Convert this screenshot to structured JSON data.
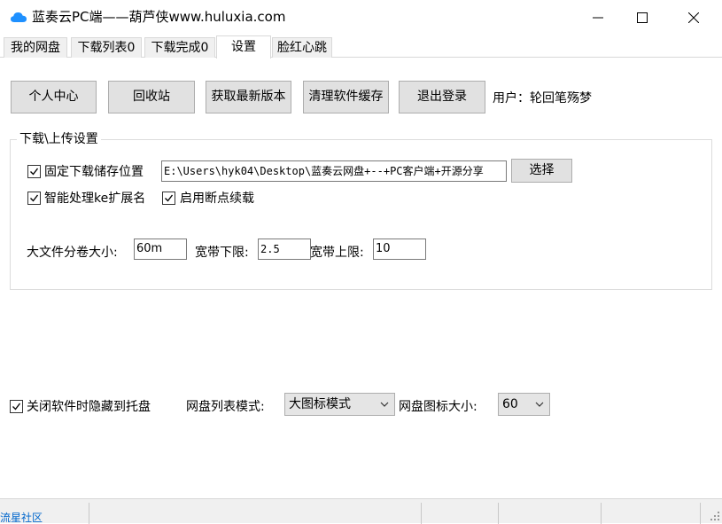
{
  "window": {
    "title": "蓝奏云PC端——葫芦侠www.huluxia.com",
    "icon": "cloud-icon",
    "icon_color": "#1e90ff"
  },
  "tabs": [
    {
      "label": "我的网盘",
      "active": false
    },
    {
      "label": "下载列表0",
      "active": false
    },
    {
      "label": "下载完成0",
      "active": false
    },
    {
      "label": "设置",
      "active": true
    },
    {
      "label": "脸红心跳",
      "active": false
    }
  ],
  "toolbar": {
    "personal_center": "个人中心",
    "recycle_bin": "回收站",
    "get_latest": "获取最新版本",
    "clear_cache": "清理软件缓存",
    "logout": "退出登录",
    "user_label": "用户：轮回笔殇梦"
  },
  "download_settings": {
    "group_title": "下载\\上传设置",
    "fixed_path_label": "固定下载储存位置",
    "fixed_path_checked": true,
    "path_value": "E:\\Users\\hyk04\\Desktop\\蓝奏云网盘+--+PC客户端+开源分享",
    "choose_button": "选择",
    "smart_ext_label": "智能处理ke扩展名",
    "smart_ext_checked": true,
    "resume_label": "启用断点续载",
    "resume_checked": true,
    "split_size_label": "大文件分卷大小:",
    "split_size_value": "60m",
    "bw_low_label": "宽带下限:",
    "bw_low_value": "2.5",
    "bw_high_label": "宽带上限:",
    "bw_high_value": "10"
  },
  "general": {
    "hide_tray_label": "关闭软件时隐藏到托盘",
    "hide_tray_checked": true,
    "list_mode_label": "网盘列表模式:",
    "list_mode_value": "大图标模式",
    "icon_size_label": "网盘图标大小:",
    "icon_size_value": "60"
  },
  "statusbar": {
    "link": "流星社区"
  }
}
